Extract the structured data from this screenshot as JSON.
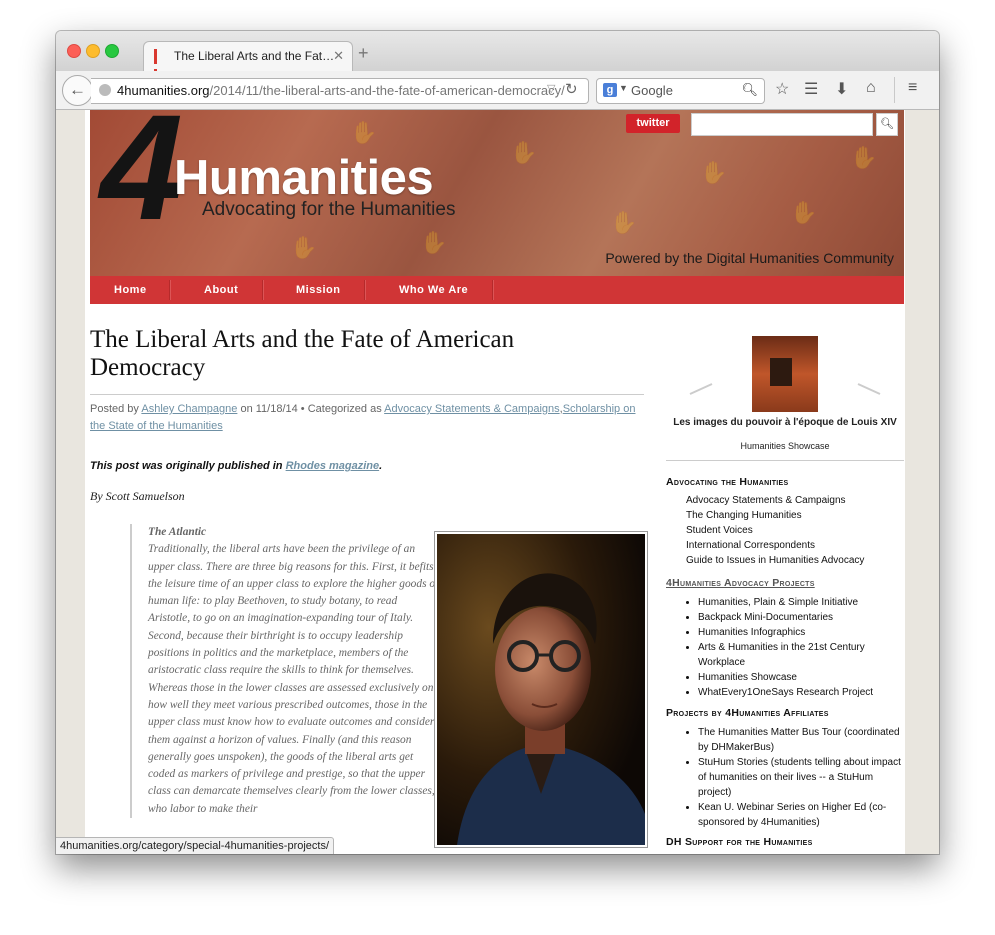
{
  "browser": {
    "tab_title": "The Liberal Arts and the Fat…",
    "tab_close": "✕",
    "new_tab": "+",
    "url_domain": "4humanities.org",
    "url_path": "/2014/11/the-liberal-arts-and-the-fate-of-american-democracy/",
    "search_placeholder": "Google",
    "status_url": "4humanities.org/category/special-4humanities-projects/"
  },
  "header": {
    "logo_number": "4",
    "logo_text": "Humanities",
    "tagline": "Advocating for the Humanities",
    "powered_by": "Powered by the Digital Humanities Community",
    "twitter_label": "twitter"
  },
  "nav": [
    "Home",
    "About",
    "Mission",
    "Who We Are"
  ],
  "article": {
    "title": "The Liberal Arts and the Fate of American Democracy",
    "posted_by_prefix": "Posted by",
    "author": "Ashley Champagne",
    "date_text": "on 11/18/14 • Categorized as",
    "category_1": "Advocacy Statements & Campaigns",
    "category_sep": ",",
    "category_2": "Scholarship on the State of the Humanities",
    "note_prefix": "This post was originally published in",
    "note_link": "Rhodes magazine",
    "note_suffix": ".",
    "byline": "By Scott Samuelson",
    "quote_source": "The Atlantic",
    "quote_text": "Traditionally, the liberal arts have been the privilege of an upper class. There are three big reasons for this. First, it befits the leisure time of an upper class to explore the higher goods of human life: to play Beethoven, to study botany, to read Aristotle, to go on an imagination-expanding tour of Italy. Second, because their birthright is to occupy leadership positions in politics and the marketplace, members of the aristocratic class require the skills to think for themselves. Whereas those in the lower classes are assessed exclusively on how well they meet various prescribed outcomes, those in the upper class must know how to evaluate outcomes and consider them against a horizon of values. Finally (and this reason generally goes unspoken), the goods of the liberal arts get coded as markers of privilege and prestige, so that the upper class can demarcate themselves clearly from the lower classes, who labor to make their"
  },
  "sidebar": {
    "showcase_title": "Les images du pouvoir à l'époque de Louis XIV",
    "showcase_caption": "Humanities Showcase",
    "section1_title": "Advocating the Humanities",
    "section1_items": [
      "Advocacy Statements & Campaigns",
      "The Changing Humanities",
      "Student Voices",
      "International Correspondents",
      "Guide to Issues in Humanities Advocacy"
    ],
    "section2_title": "4Humanities Advocacy Projects",
    "section2_items": [
      "Humanities, Plain & Simple Initiative",
      "Backpack Mini-Documentaries",
      "Humanities Infographics",
      "Arts & Humanities in the 21st Century Workplace",
      "Humanities Showcase",
      "WhatEvery1OneSays Research Project"
    ],
    "section3_title": "Projects by 4Humanities Affiliates",
    "section3_items": [
      "The Humanities Matter Bus Tour (coordinated by DHMakerBus)",
      "StuHum Stories (students telling about impact of humanities on their lives -- a StuHum project)",
      "Kean U. Webinar Series on Higher Ed (co-sponsored by 4Humanities)"
    ],
    "section4_title": "DH Support for the Humanities"
  },
  "colors": {
    "nav_red": "#d03536",
    "twitter_red": "#d2232a",
    "link": "#6f90a4"
  },
  "icons": [
    "back-arrow-icon",
    "globe-icon",
    "reload-icon",
    "google-icon",
    "search-icon",
    "star-icon",
    "reading-list-icon",
    "download-icon",
    "home-icon",
    "menu-icon"
  ]
}
